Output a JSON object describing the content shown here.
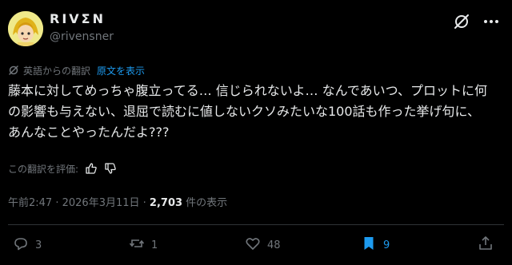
{
  "author": {
    "display_name": "RIVΣN",
    "handle": "@rivensner"
  },
  "translation": {
    "label": "英語からの翻訳",
    "show_original": "原文を表示"
  },
  "tweet": {
    "text": "藤本に対してめっちゃ腹立ってる… 信じられないよ… なんであいつ、プロットに何の影響も与えない、退屈で読むに値しないクソみたいな100話も作った挙げ句に、あんなことやったんだよ???"
  },
  "rating": {
    "label": "この翻訳を評価:"
  },
  "meta": {
    "time": "午前2:47",
    "sep1": " · ",
    "date": "2026年3月11日",
    "sep2": " · ",
    "views_count": "2,703",
    "views_label": " 件の表示"
  },
  "actions": {
    "replies": "3",
    "reposts": "1",
    "likes": "48",
    "bookmarks": "9"
  },
  "colors": {
    "background": "#000000",
    "text": "#e7e9ea",
    "secondary": "#71767b",
    "accent": "#1d9bf0"
  },
  "icons": {
    "grok": "grok-icon",
    "more": "more-icon",
    "translate": "translate-icon",
    "reply": "reply-icon",
    "repost": "repost-icon",
    "like": "like-icon",
    "bookmark": "bookmark-icon",
    "share": "share-icon",
    "thumbs_up": "thumbs-up-icon",
    "thumbs_down": "thumbs-down-icon"
  }
}
